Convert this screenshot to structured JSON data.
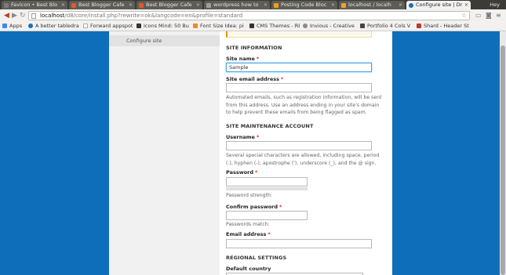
{
  "browser": {
    "tabs": [
      {
        "label": "Favicon • Best Blo",
        "color": "#7b7b7b",
        "active": false
      },
      {
        "label": "Best Blogger Cafe",
        "color": "#e05a2b",
        "active": false
      },
      {
        "label": "Best Blogger Cafe",
        "color": "#e05a2b",
        "active": false
      },
      {
        "label": "wordpress how to",
        "color": "#9e9e9e",
        "active": false
      },
      {
        "label": "Posting Code Bloc",
        "color": "#f39c12",
        "active": false
      },
      {
        "label": "localhost / localh",
        "color": "#f0a030",
        "active": false
      },
      {
        "label": "Configure site | Dr",
        "color": "#1a6eb0",
        "active": true
      }
    ],
    "user_label": "Hey",
    "url_host": "localhost",
    "url_path": "/d8/core/install.php?rewrite=ok&langcode=en&profile=standard",
    "bookmarks": [
      {
        "label": "Apps",
        "color": "#4285f4"
      },
      {
        "label": "A better tabledra",
        "color": "#1c6fb5"
      },
      {
        "label": "Forward appspot",
        "color": "#cfcfcf"
      },
      {
        "label": "Icons Mind: 50 Bu",
        "color": "#333333"
      },
      {
        "label": "Font Size Idea: pi",
        "color": "#f08a24"
      },
      {
        "label": "CMS Themes - RE",
        "color": "#333333"
      },
      {
        "label": "Invious - Creative",
        "color": "#8a8a8a"
      },
      {
        "label": "Portfolio 4 Cols V",
        "color": "#444444"
      },
      {
        "label": "Shard - Header St",
        "color": "#c0392b"
      }
    ]
  },
  "sidebar": {
    "active_step": "Configure site"
  },
  "form": {
    "site_info_heading": "SITE INFORMATION",
    "site_name_label": "Site name",
    "site_name_value": "Sample",
    "site_email_label": "Site email address",
    "site_email_desc": [
      "Automated emails, such as registration information, will be sent",
      "from this address. Use an address ending in your site's domain",
      "to help prevent these emails from being flagged as spam."
    ],
    "maintenance_heading": "SITE MAINTENANCE ACCOUNT",
    "username_label": "Username",
    "username_desc": [
      "Several special characters are allowed, including space, period",
      "(.), hyphen (-), apostrophe ('), underscore (_), and the @ sign."
    ],
    "password_label": "Password",
    "password_strength": "Password strength:",
    "confirm_password_label": "Confirm password",
    "passwords_match": "Passwords match:",
    "email_label": "Email address",
    "regional_heading": "REGIONAL SETTINGS",
    "default_country_label": "Default country",
    "required_mark": "*"
  }
}
